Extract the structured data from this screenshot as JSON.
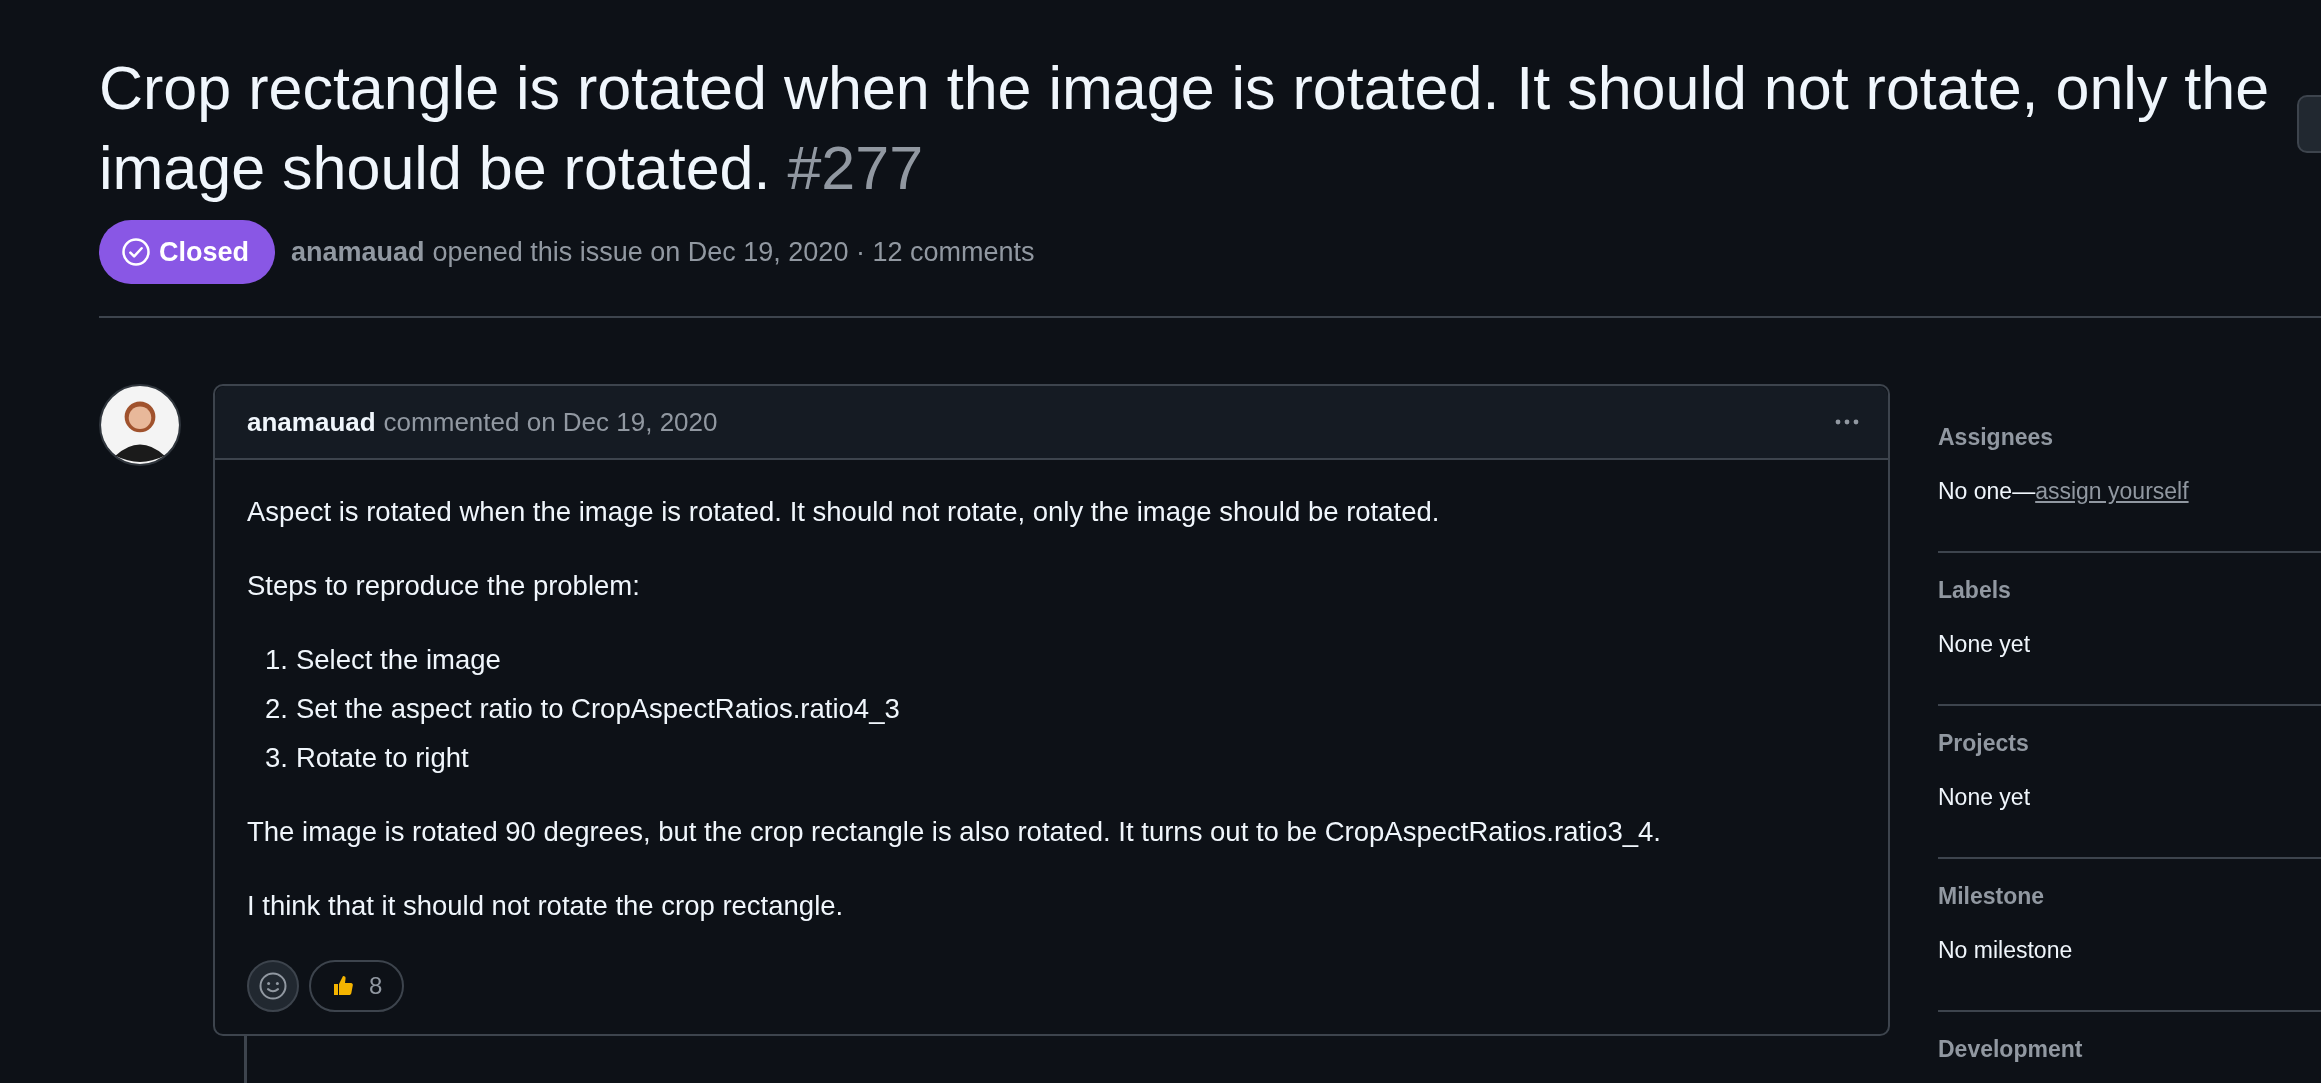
{
  "issue": {
    "title": "Crop rectangle is rotated when the image is rotated. It should not rotate, only the image should be rotated.",
    "number": "#277",
    "status": {
      "label": "Closed",
      "kind": "closed"
    },
    "author": "anamauad",
    "meta": "opened this issue on Dec 19, 2020 · 12 comments"
  },
  "comment": {
    "author": "anamauad",
    "meta": "commented on Dec 19, 2020",
    "body": [
      {
        "kind": "paragraph",
        "text": "Aspect is rotated when the image is rotated. It should not rotate, only the image should be rotated."
      },
      {
        "kind": "paragraph",
        "text": "Steps to reproduce the problem:"
      },
      {
        "kind": "list",
        "items": [
          {
            "number": "1.",
            "text": "Select the image"
          },
          {
            "number": "2.",
            "text": "Set the aspect ratio to CropAspectRatios.ratio4_3"
          },
          {
            "number": "3.",
            "text": "Rotate to right"
          }
        ]
      },
      {
        "kind": "paragraph",
        "text": "The image is rotated 90 degrees, but the crop rectangle is also rotated. It turns out to be CropAspectRatios.ratio3_4."
      },
      {
        "kind": "paragraph",
        "text": "I think that it should not rotate the crop rectangle."
      }
    ],
    "reactions": [
      {
        "kind": "thumbs-up",
        "count": "8"
      }
    ]
  },
  "sidebar": [
    {
      "heading": "Assignees",
      "value": "No one—",
      "link": "assign yourself"
    },
    {
      "heading": "Labels",
      "value": "None yet"
    },
    {
      "heading": "Projects",
      "value": "None yet"
    },
    {
      "heading": "Milestone",
      "value": "No milestone"
    },
    {
      "heading": "Development"
    }
  ]
}
